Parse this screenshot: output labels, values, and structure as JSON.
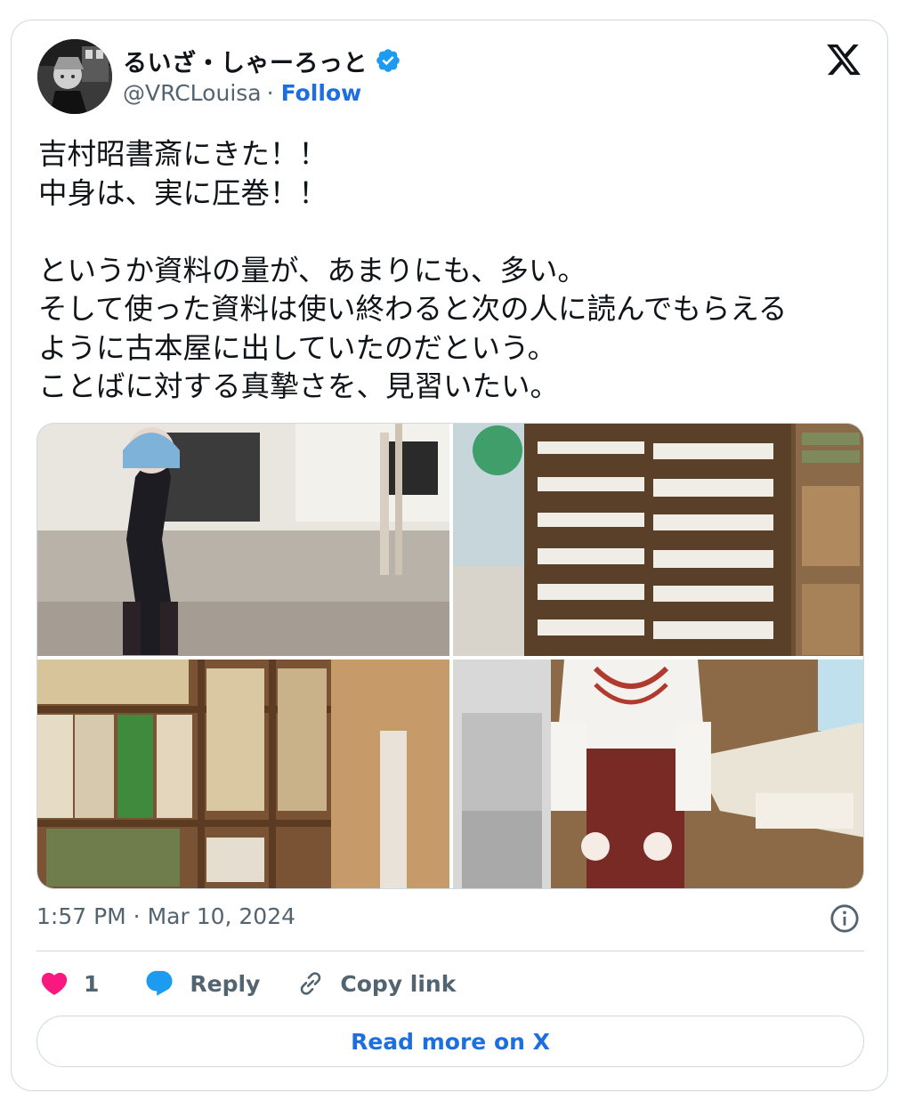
{
  "author": {
    "display_name": "るいざ・しゃーろっと",
    "handle": "@VRCLouisa",
    "separator": "·",
    "follow_label": "Follow"
  },
  "tweet": {
    "text": "吉村昭書斎にきた！！\n中身は、実に圧巻！！\n\nというか資料の量が、あまりにも、多い。\nそして使った資料は使い終わると次の人に読んでもらえる\nように古本屋に出していたのだという。\nことばに対する真摯さを、見習いたい。"
  },
  "meta": {
    "timestamp": "1:57 PM · Mar 10, 2024"
  },
  "actions": {
    "like_count": "1",
    "reply_label": "Reply",
    "copy_link_label": "Copy link"
  },
  "read_more_label": "Read more on X",
  "colors": {
    "link_blue": "#1d6fe0",
    "verified_blue": "#1d9bf0",
    "like_red": "#f91880",
    "secondary_text": "#536471",
    "border": "#cfd9de"
  },
  "icons": [
    "verified-badge-icon",
    "x-logo-icon",
    "info-icon",
    "heart-icon",
    "reply-bubble-icon",
    "link-icon"
  ]
}
